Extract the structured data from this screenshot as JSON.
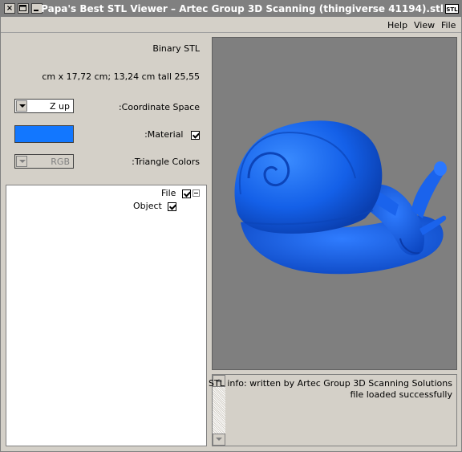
{
  "window": {
    "title": "Papa's Best STL Viewer – Artec Group 3D Scanning (thingiverse 41194).stl",
    "title_icon": "STL",
    "buttons": [
      "close-icon",
      "maximize-icon",
      "minimize-icon"
    ]
  },
  "menu": {
    "help": "Help",
    "view": "View",
    "file": "File"
  },
  "props": {
    "format": "Binary STL",
    "dimensions": "cm x 17,72 cm; 13,24 cm tall 25,55",
    "coordinate_space_label": ":Coordinate Space",
    "coordinate_space_value": "Z up",
    "material_label": ":Material",
    "material_color": "#1277ff",
    "material_checked": true,
    "triangle_colors_label": ":Triangle Colors",
    "triangle_colors_value": "RGB"
  },
  "tree": {
    "items": [
      {
        "label": "File",
        "checked": true
      },
      {
        "label": "Object",
        "checked": true
      }
    ]
  },
  "viewport": {
    "background": "#7f7f7f",
    "model_color": "#1a5fe0",
    "model": "snail"
  },
  "info": {
    "line1": "STL info: written by Artec Group 3D Scanning Solutions",
    "line2": "file loaded successfully"
  }
}
